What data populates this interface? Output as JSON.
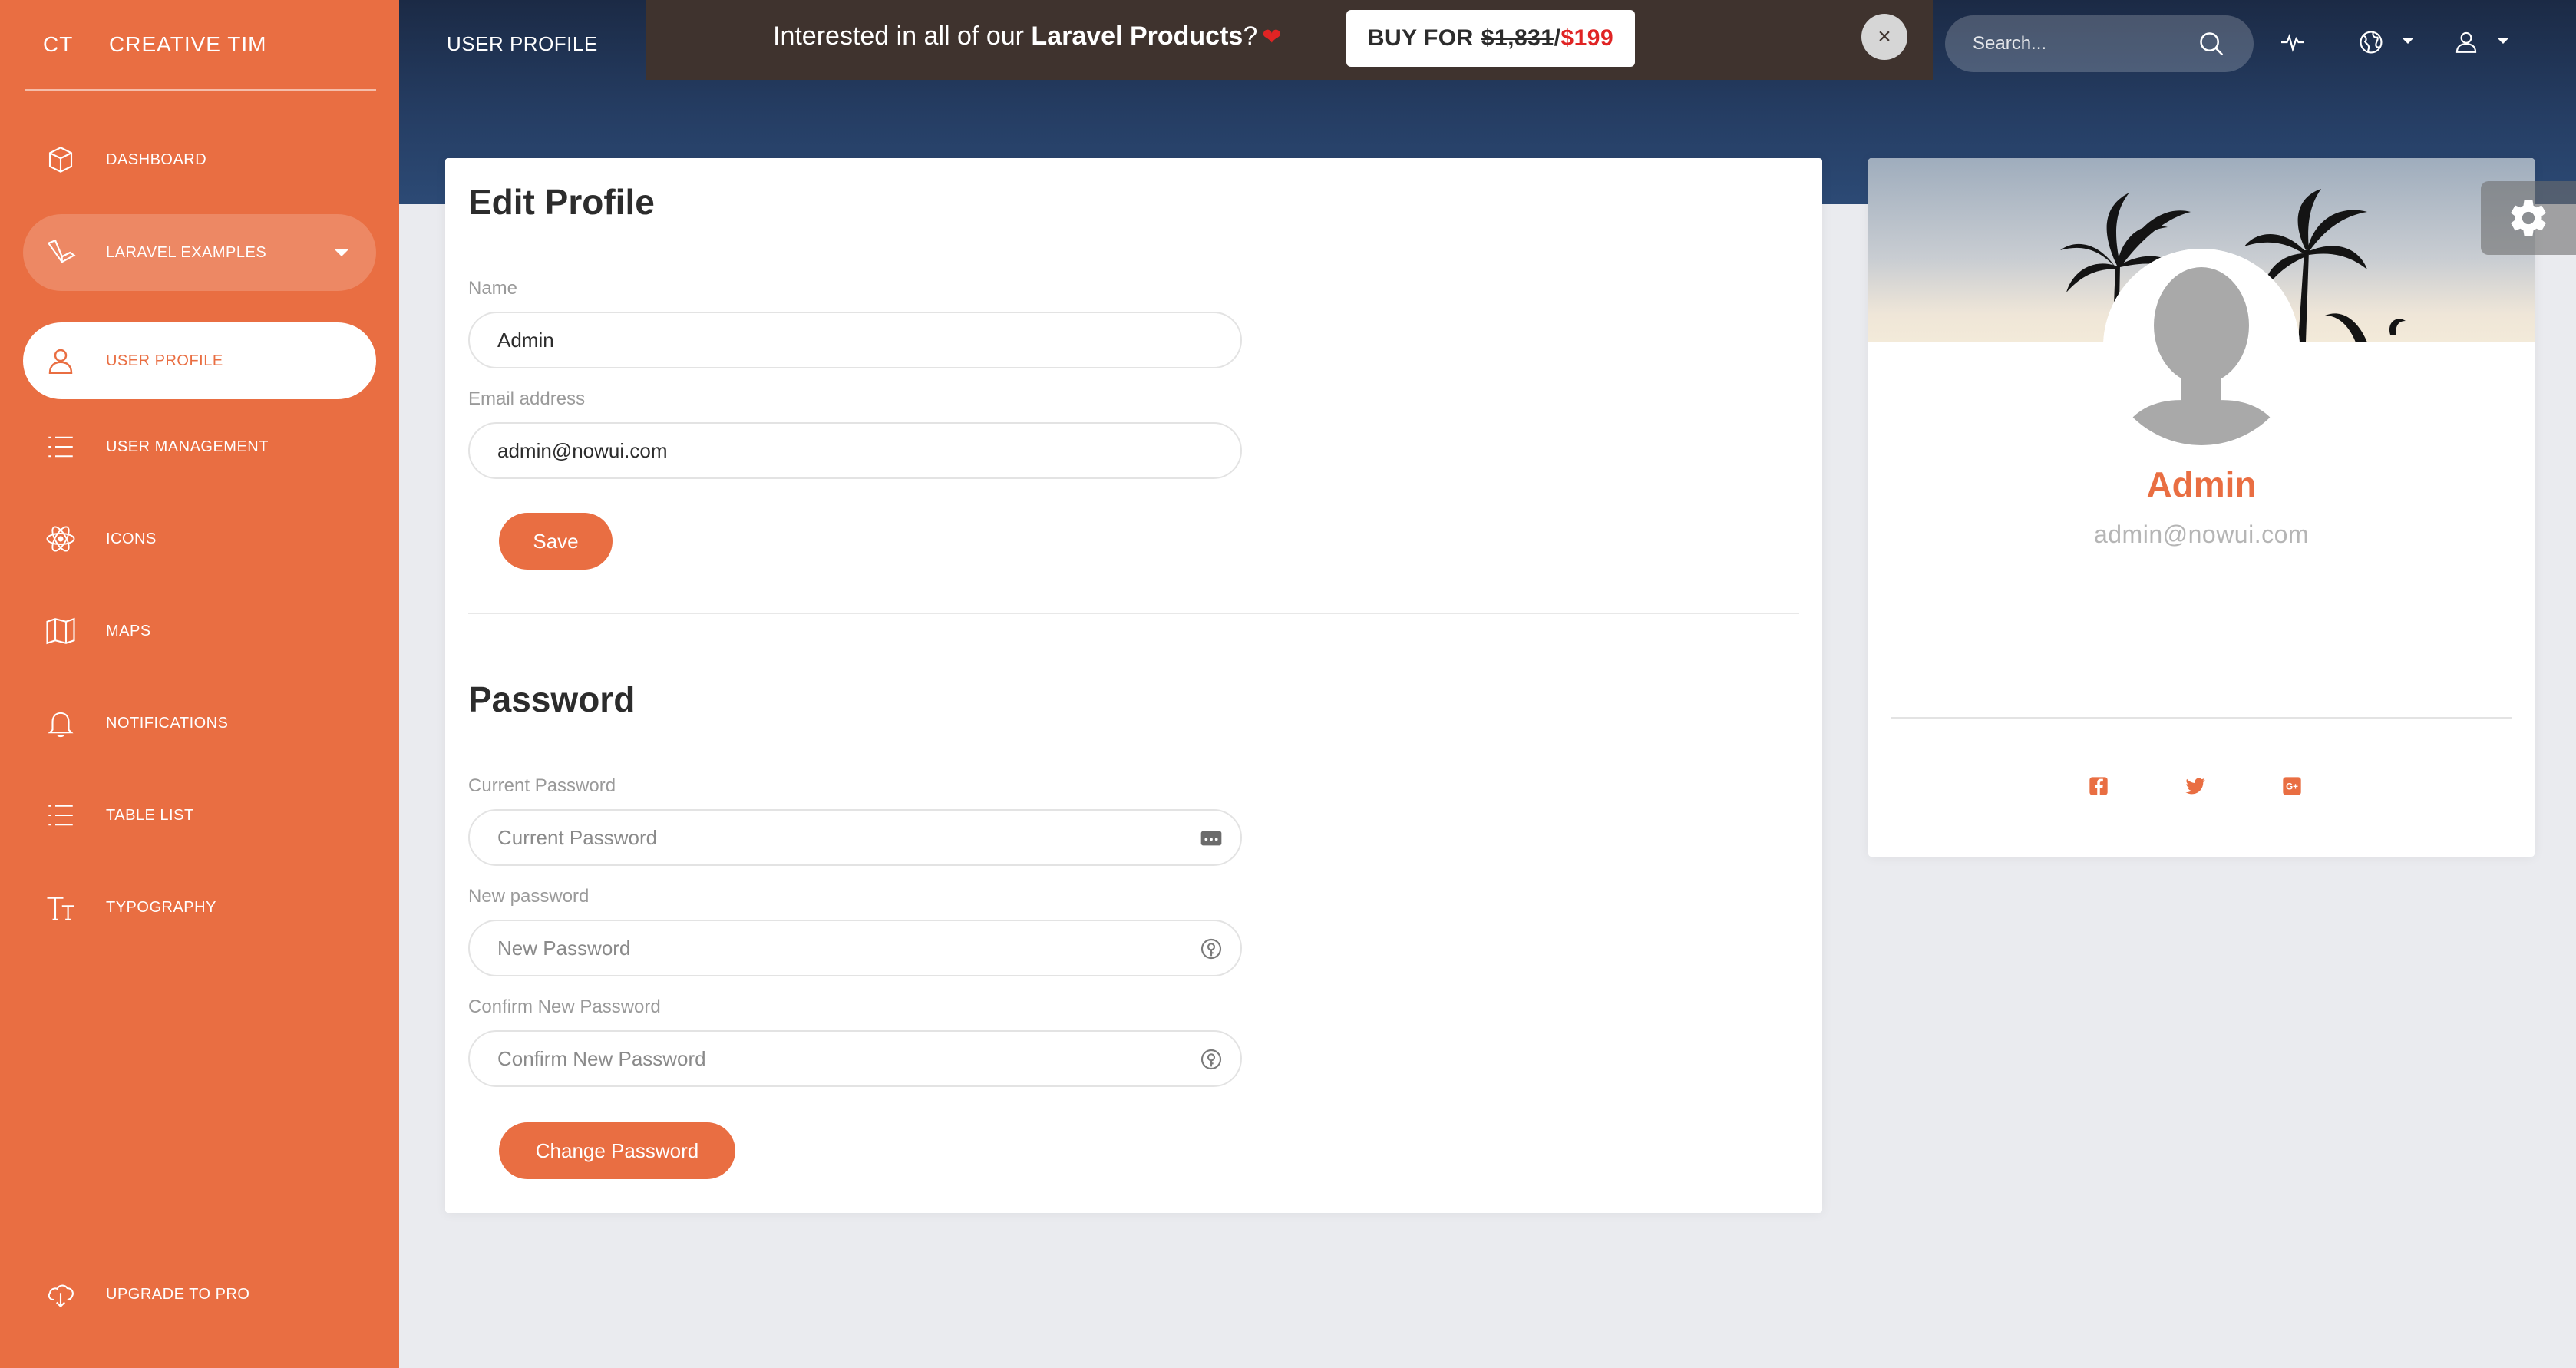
{
  "brand": {
    "mini": "CT",
    "full": "CREATIVE TIM"
  },
  "sidebar": {
    "items": [
      {
        "label": "DASHBOARD",
        "icon": "cube-icon"
      },
      {
        "label": "LARAVEL EXAMPLES",
        "icon": "laravel-icon"
      },
      {
        "label": "USER PROFILE",
        "icon": "user-icon"
      },
      {
        "label": "USER MANAGEMENT",
        "icon": "list-icon"
      },
      {
        "label": "ICONS",
        "icon": "atom-icon"
      },
      {
        "label": "MAPS",
        "icon": "map-icon"
      },
      {
        "label": "NOTIFICATIONS",
        "icon": "bell-icon"
      },
      {
        "label": "TABLE LIST",
        "icon": "list-icon"
      },
      {
        "label": "TYPOGRAPHY",
        "icon": "text-icon"
      }
    ],
    "upgrade": {
      "label": "UPGRADE TO PRO",
      "icon": "cloud-download-icon"
    }
  },
  "header": {
    "page_title": "USER PROFILE",
    "search_placeholder": "Search..."
  },
  "promo": {
    "text_pre": "Interested in all of our ",
    "text_bold": "Laravel Products",
    "text_post": "?",
    "heart": "❤",
    "buy_label": "BUY FOR",
    "old_price": "$1,831",
    "separator": "/",
    "new_price": "$199",
    "close": "×"
  },
  "edit_profile": {
    "title": "Edit Profile",
    "name_label": "Name",
    "name_value": "Admin",
    "email_label": "Email address",
    "email_value": "admin@nowui.com",
    "save_label": "Save"
  },
  "password": {
    "title": "Password",
    "current_label": "Current Password",
    "current_placeholder": "Current Password",
    "new_label": "New password",
    "new_placeholder": "New Password",
    "confirm_label": "Confirm New Password",
    "confirm_placeholder": "Confirm New Password",
    "change_label": "Change Password"
  },
  "user_card": {
    "name": "Admin",
    "email": "admin@nowui.com"
  },
  "colors": {
    "primary": "#e96e42",
    "header_dark": "#1b2a45",
    "promo_bg": "#3f332e",
    "price_red": "#e02424"
  }
}
